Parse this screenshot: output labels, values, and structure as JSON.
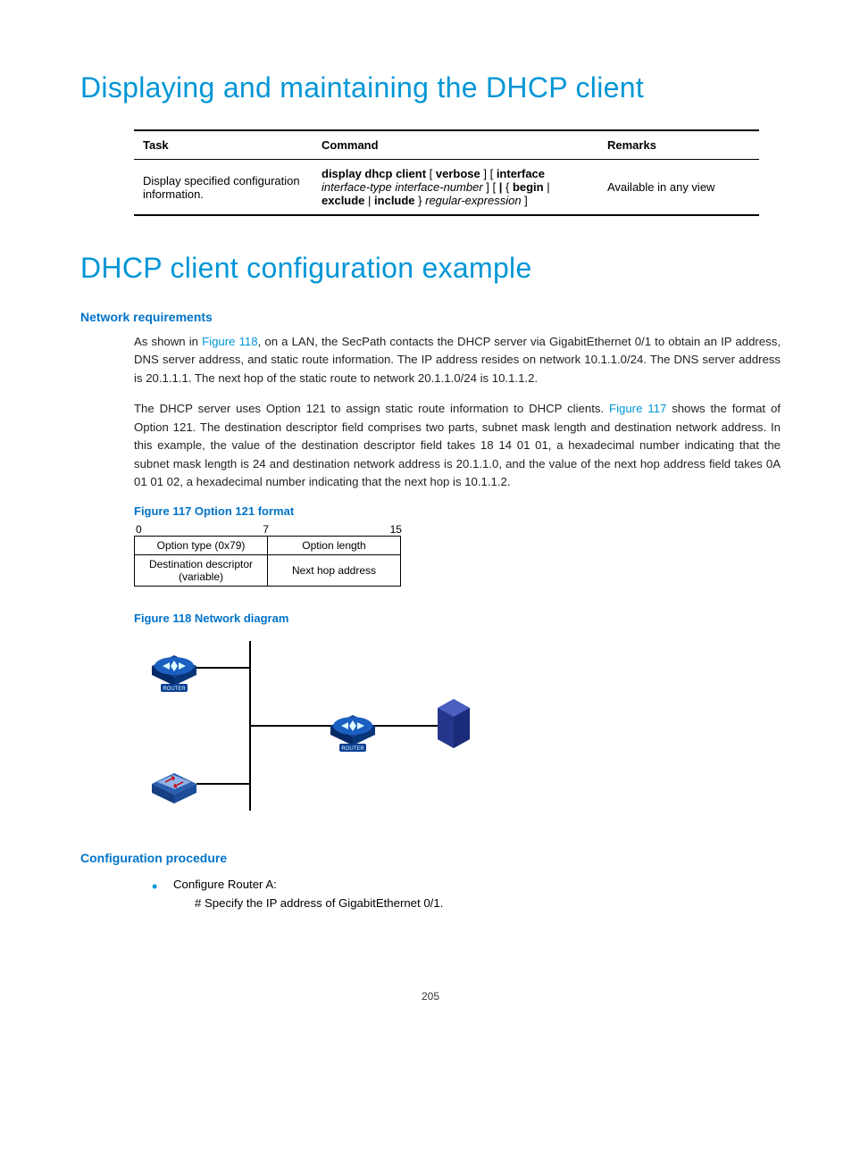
{
  "h1a": "Displaying and maintaining the DHCP client",
  "table": {
    "headers": {
      "task": "Task",
      "command": "Command",
      "remarks": "Remarks"
    },
    "row": {
      "task": "Display specified configuration information.",
      "cmd_parts": {
        "p1": "display dhcp client",
        "p2": " [ ",
        "p3": "verbose",
        "p4": " ] [ ",
        "p5": "interface",
        "p6": " ",
        "p7": "interface-type interface-number",
        "p8": " ] [ ",
        "p9": "|",
        "p10": " { ",
        "p11": "begin",
        "p12": " | ",
        "p13": "exclude",
        "p14": " | ",
        "p15": "include",
        "p16": " } ",
        "p17": "regular-expression",
        "p18": " ]"
      },
      "remarks": "Available in any view"
    }
  },
  "h1b": "DHCP client configuration example",
  "s1": "Network requirements",
  "para1a": "As shown in ",
  "fig118link": "Figure 118",
  "para1b": ", on a LAN, the SecPath contacts the DHCP server via GigabitEthernet 0/1 to obtain an IP address, DNS server address, and static route information. The IP address resides on network 10.1.1.0/24. The DNS server address is 20.1.1.1. The next hop of the static route to network 20.1.1.0/24 is 10.1.1.2.",
  "para2a": "The DHCP server uses Option 121 to assign static route information to DHCP clients. ",
  "fig117link": "Figure 117",
  "para2b": " shows the format of Option 121. The destination descriptor field comprises two parts, subnet mask length and destination network address. In this example, the value of the destination descriptor field takes 18 14 01 01, a hexadecimal number indicating that the subnet mask length is 24 and destination network address is 20.1.1.0, and the value of the next hop address field takes 0A 01 01 02, a hexadecimal number indicating that the next hop is 10.1.1.2.",
  "fig117cap": "Figure 117 Option 121 format",
  "opt121": {
    "ruler": {
      "a": "0",
      "b": "7",
      "c": "15"
    },
    "c1": "Option type (0x79)",
    "c2": "Option length",
    "c3": "Destination descriptor (variable)",
    "c4": "Next hop address"
  },
  "fig118cap": "Figure 118 Network diagram",
  "diagram": {
    "router_label": "ROUTER"
  },
  "s2": "Configuration procedure",
  "proc1": "Configure Router A:",
  "proc1a": "# Specify the IP address of GigabitEthernet 0/1.",
  "pagenum": "205"
}
